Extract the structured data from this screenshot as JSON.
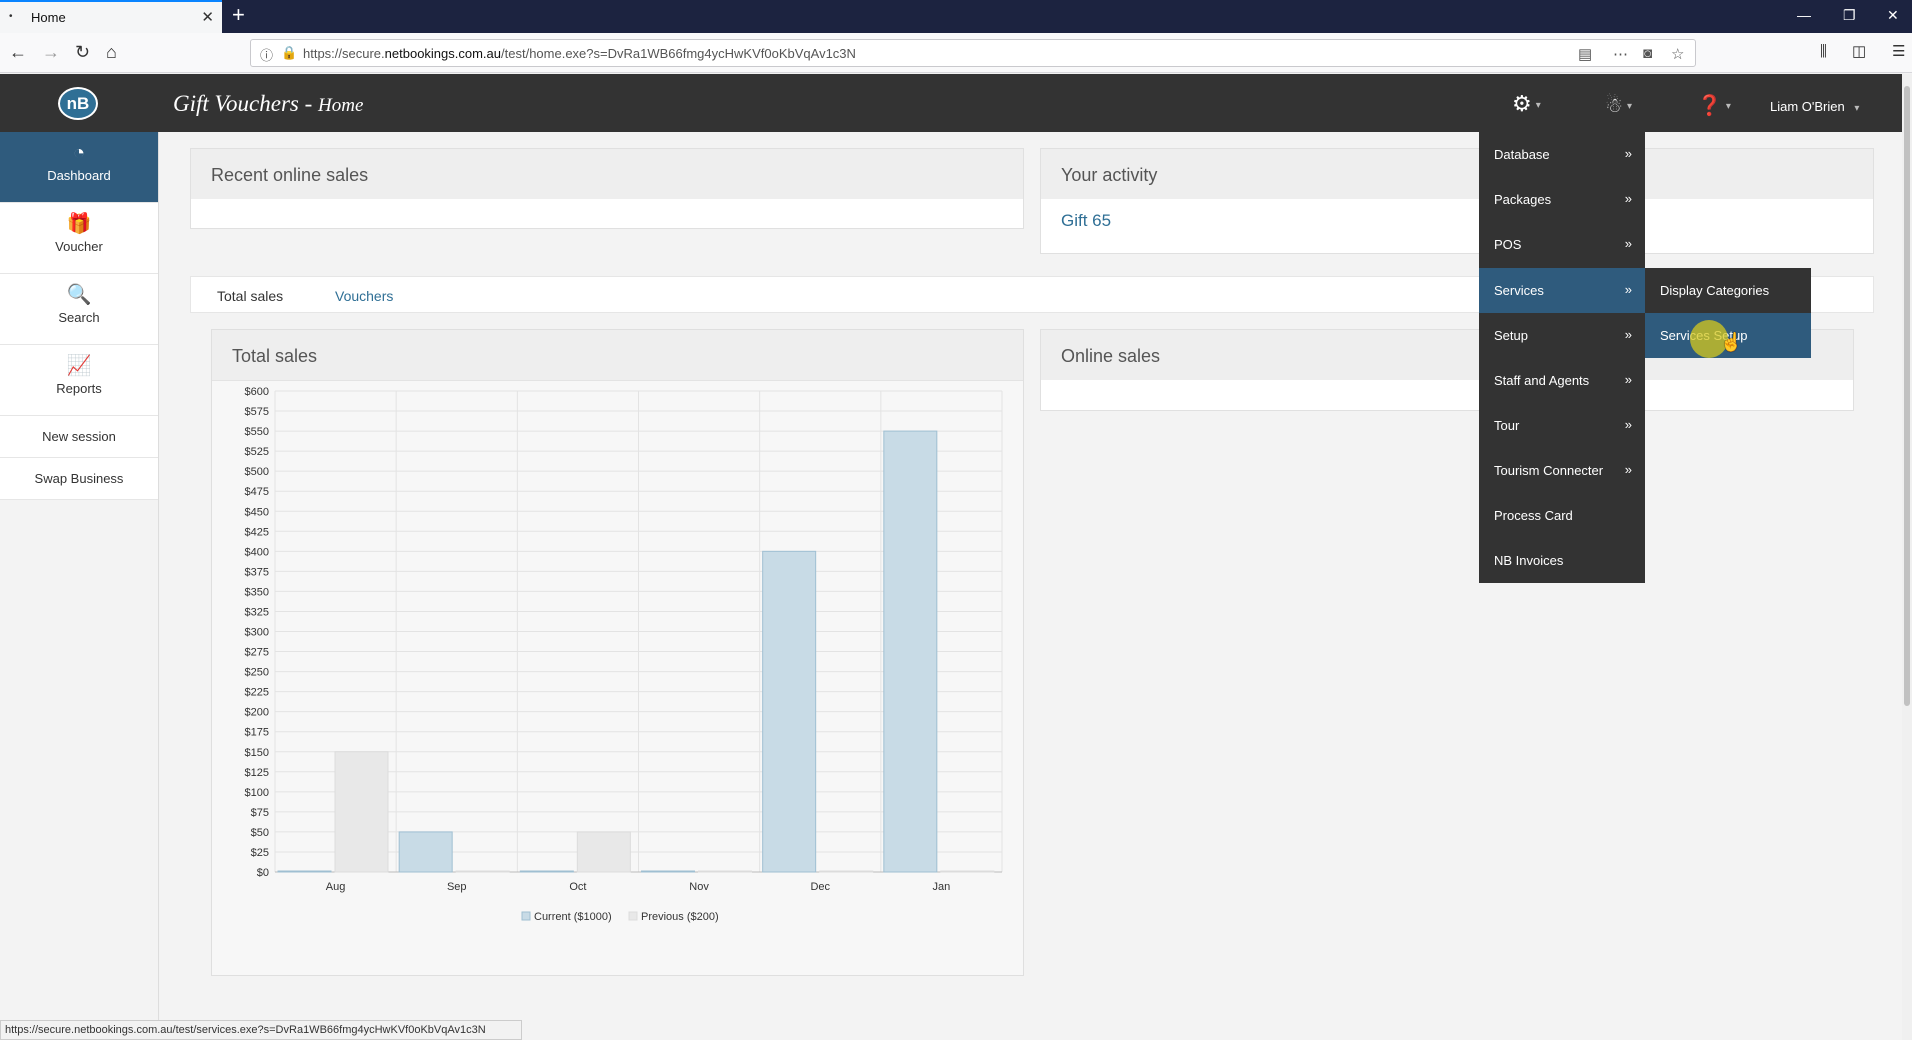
{
  "browser": {
    "tab_title": "Home",
    "tab_dot": "•",
    "url_prefix": "https://secure.",
    "url_domain": "netbookings.com.au",
    "url_path": "/test/home.exe?s=DvRa1WB66fmg4ycHwKVf0oKbVqAv1c3N",
    "status_url": "https://secure.netbookings.com.au/test/services.exe?s=DvRa1WB66fmg4ycHwKVf0oKbVqAv1c3N"
  },
  "app": {
    "logo": "nB",
    "title": "Gift Vouchers - ",
    "title_sub": "Home",
    "user": "Liam O'Brien"
  },
  "sidebar": {
    "items": [
      {
        "label": "Dashboard",
        "icon": "dashboard-icon"
      },
      {
        "label": "Voucher",
        "icon": "gift-icon"
      },
      {
        "label": "Search",
        "icon": "search-icon"
      },
      {
        "label": "Reports",
        "icon": "chart-icon"
      },
      {
        "label": "New session"
      },
      {
        "label": "Swap Business"
      }
    ]
  },
  "panels": {
    "recent_online_sales": "Recent online sales",
    "your_activity": "Your activity",
    "activity_link": "Gift 65",
    "online_sales": "Online sales"
  },
  "tabs": [
    "Total sales",
    "Vouchers"
  ],
  "chart_title": "Total sales",
  "chart_data": {
    "type": "bar",
    "categories": [
      "Aug",
      "Sep",
      "Oct",
      "Nov",
      "Dec",
      "Jan"
    ],
    "series": [
      {
        "name": "Current ($1000)",
        "values": [
          0,
          50,
          0,
          0,
          400,
          550
        ],
        "color": "#c8dbe6"
      },
      {
        "name": "Previous ($200)",
        "values": [
          150,
          0,
          50,
          0,
          0,
          0
        ],
        "color": "#e8e8e8"
      }
    ],
    "yticks": [
      "$0",
      "$25",
      "$50",
      "$75",
      "$100",
      "$125",
      "$150",
      "$175",
      "$200",
      "$225",
      "$250",
      "$275",
      "$300",
      "$325",
      "$350",
      "$375",
      "$400",
      "$425",
      "$450",
      "$475",
      "$500",
      "$525",
      "$550",
      "$575",
      "$600"
    ],
    "ylim": [
      0,
      600
    ],
    "legend": "bottom-center",
    "grid": true
  },
  "menu": {
    "items": [
      {
        "label": "Database",
        "arrow": "»"
      },
      {
        "label": "Packages",
        "arrow": "»"
      },
      {
        "label": "POS",
        "arrow": "»"
      },
      {
        "label": "Services",
        "arrow": "»"
      },
      {
        "label": "Setup",
        "arrow": "»"
      },
      {
        "label": "Staff and Agents",
        "arrow": "»"
      },
      {
        "label": "Tour",
        "arrow": "»"
      },
      {
        "label": "Tourism Connecter",
        "arrow": "»"
      },
      {
        "label": "Process Card",
        "arrow": ""
      },
      {
        "label": "NB Invoices",
        "arrow": ""
      }
    ],
    "submenu": [
      "Display Categories",
      "Services Setup"
    ]
  }
}
